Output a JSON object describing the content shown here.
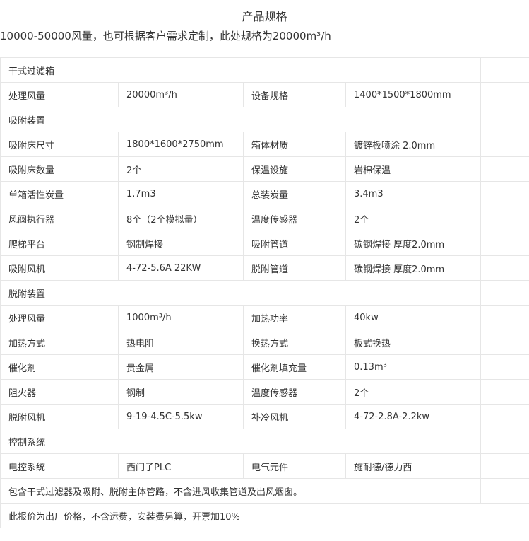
{
  "title": "产品规格",
  "subtitle": "10000-50000风量，也可根据客户需求定制，此处规格为20000m³/h",
  "rows": [
    {
      "type": "section",
      "cells": [
        "干式过滤箱"
      ]
    },
    {
      "type": "data",
      "cells": [
        "处理风量",
        "20000m³/h",
        "设备规格",
        "1400*1500*1800mm"
      ]
    },
    {
      "type": "section",
      "cells": [
        "吸附装置"
      ]
    },
    {
      "type": "data",
      "cells": [
        "吸附床尺寸",
        "1800*1600*2750mm",
        "箱体材质",
        "镀锌板喷涂 2.0mm"
      ]
    },
    {
      "type": "data",
      "cells": [
        "吸附床数量",
        "2个",
        "保温设施",
        "岩棉保温"
      ]
    },
    {
      "type": "data",
      "cells": [
        "单箱活性炭量",
        "1.7m3",
        "总装炭量",
        "3.4m3"
      ]
    },
    {
      "type": "data",
      "cells": [
        "风阀执行器",
        "8个（2个模拟量）",
        "温度传感器",
        "2个"
      ]
    },
    {
      "type": "data",
      "cells": [
        "爬梯平台",
        "钢制焊接",
        "吸附管道",
        "碳钢焊接 厚度2.0mm"
      ]
    },
    {
      "type": "data",
      "cells": [
        "吸附风机",
        "4-72-5.6A 22KW",
        "脱附管道",
        "碳钢焊接 厚度2.0mm"
      ]
    },
    {
      "type": "section",
      "cells": [
        "脱附装置"
      ]
    },
    {
      "type": "data",
      "cells": [
        "处理风量",
        "1000m³/h",
        "加热功率",
        "40kw"
      ]
    },
    {
      "type": "data",
      "cells": [
        "加热方式",
        "热电阻",
        "换热方式",
        "板式换热"
      ]
    },
    {
      "type": "data",
      "cells": [
        "催化剂",
        "贵金属",
        "催化剂填充量",
        "0.13m³"
      ]
    },
    {
      "type": "data",
      "cells": [
        "阻火器",
        "钢制",
        "温度传感器",
        "2个"
      ]
    },
    {
      "type": "data",
      "cells": [
        "脱附风机",
        "9-19-4.5C-5.5kw",
        "补冷风机",
        "4-72-2.8A-2.2kw"
      ]
    },
    {
      "type": "section",
      "cells": [
        "控制系统"
      ]
    },
    {
      "type": "data",
      "cells": [
        "电控系统",
        "西门子PLC",
        "电气元件",
        "施耐德/德力西"
      ]
    },
    {
      "type": "section",
      "cells": [
        "包含干式过滤器及吸附、脱附主体管路，不含进风收集管道及出风烟囱。"
      ]
    },
    {
      "type": "final",
      "cells": [
        "此报价为出厂价格，不含运费，安装费另算，开票加10%"
      ]
    }
  ]
}
